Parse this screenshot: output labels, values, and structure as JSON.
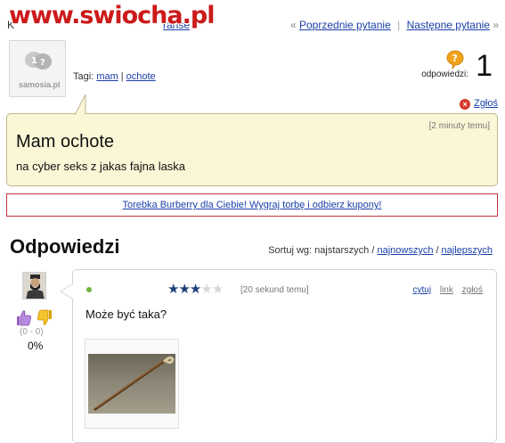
{
  "watermark": {
    "text": "www.swiocha.pl"
  },
  "breadcrumb": {
    "start": "K",
    "tail": "ranse"
  },
  "topnav": {
    "prev_arrow": "«",
    "prev_label": "Poprzednie pytanie",
    "separator": "|",
    "next_label": "Następne pytanie",
    "next_arrow": "»"
  },
  "question": {
    "avatar_brand": "samosia.pl",
    "tags_label": "Tagi:",
    "tags": [
      "mam",
      "ochote"
    ],
    "tag_separator": "|",
    "answers_label": "odpowiedzi:",
    "answers_count": "1",
    "report_label": "Zgłoś",
    "time": "[2 minuty temu]",
    "title": "Mam ochote",
    "body": "na cyber seks z jakas fajna laska"
  },
  "ad": {
    "text": "Torebka Burberry dla Ciebie! Wygraj torbę i odbierz kupony!"
  },
  "answers_section": {
    "title": "Odpowiedzi",
    "sort_label": "Sortuj wg: najstarszych /",
    "sort_options": [
      "najnowszych",
      "najlepszych"
    ],
    "sort_separator": "/"
  },
  "answer": {
    "rating": 3,
    "rating_max": 5,
    "time": "[20 sekund temu]",
    "actions": {
      "quote": "cytuj",
      "link": "link",
      "report": "zgłoś"
    },
    "text": "Może być taka?",
    "votes": "(0 - 0)",
    "votes_percent": "0%",
    "status_color": "#6fb33c"
  },
  "colors": {
    "link": "#1a3fa8",
    "question_bg": "#fbf6d6",
    "ad_border": "#c0353a",
    "star_on": "#1f3f7a",
    "watermark": "#cc1a1a"
  },
  "icons": {
    "answers": "question-bubble-icon",
    "report": "close-icon",
    "vote_up": "thumbs-up-icon",
    "vote_down": "thumbs-down-icon"
  }
}
